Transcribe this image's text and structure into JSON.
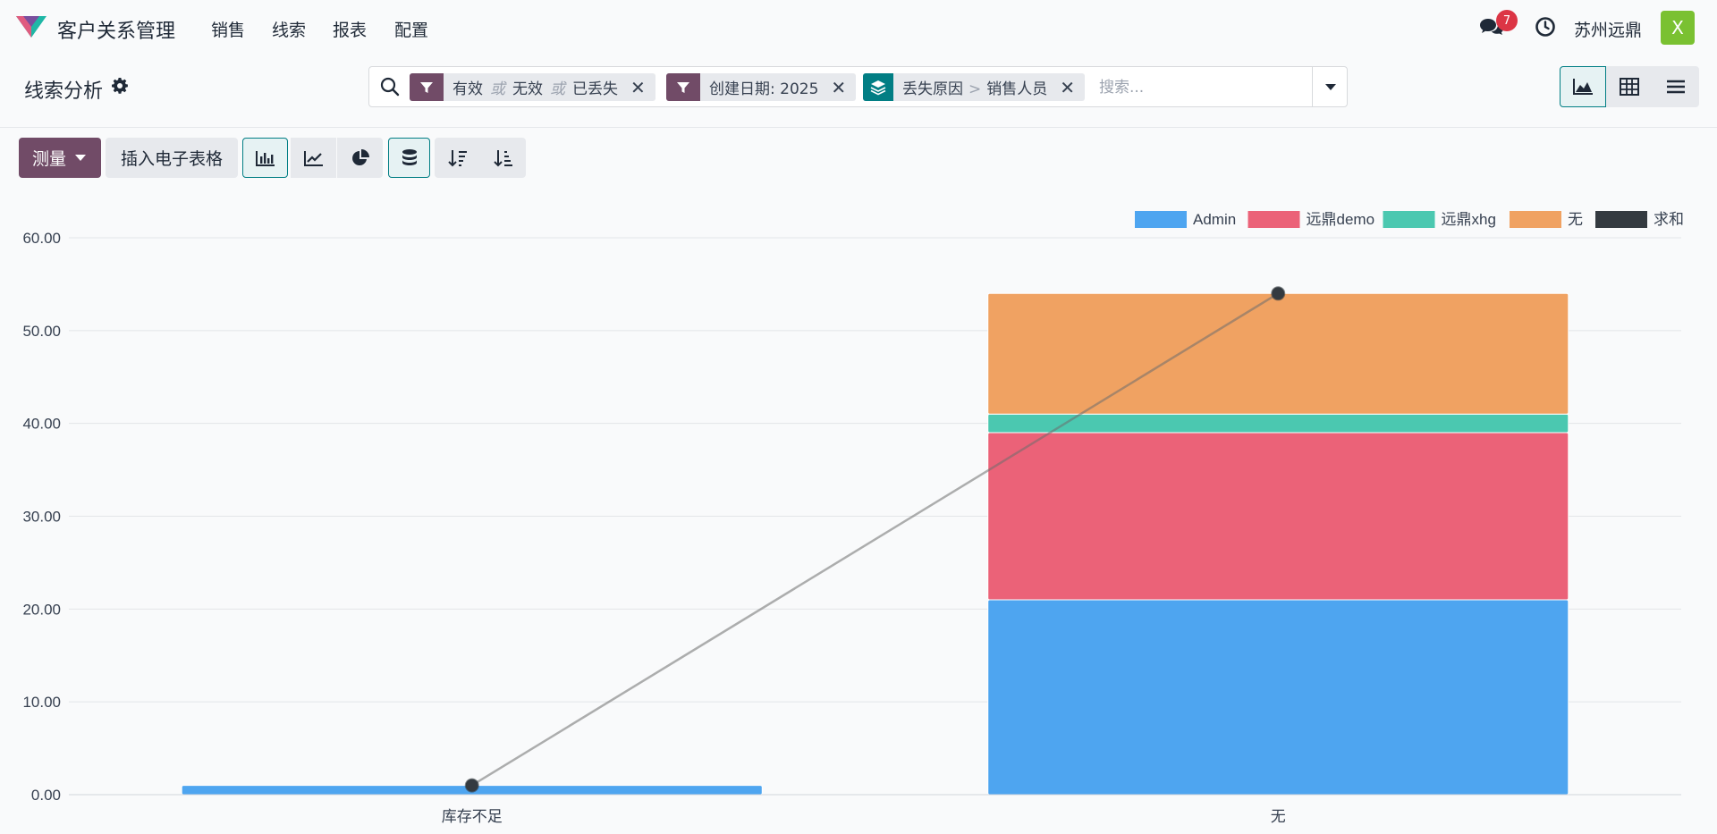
{
  "app": {
    "name": "客户关系管理"
  },
  "nav": {
    "items": [
      "销售",
      "线索",
      "报表",
      "配置"
    ]
  },
  "systray": {
    "messages_count": "7",
    "company": "苏州远鼎",
    "avatar_letter": "X"
  },
  "control_panel": {
    "title": "线索分析",
    "search": {
      "placeholder": "搜索...",
      "facets": [
        {
          "type": "filter",
          "values": [
            "有效",
            "无效",
            "已丢失"
          ],
          "separator": "或"
        },
        {
          "type": "filter",
          "values": [
            "创建日期: 2025"
          ]
        },
        {
          "type": "groupby",
          "values": [
            "丢失原因",
            "销售人员"
          ],
          "separator": ">"
        }
      ]
    },
    "views": [
      "graph",
      "pivot",
      "list"
    ],
    "active_view": "graph"
  },
  "toolbar": {
    "measure_label": "测量",
    "spreadsheet_label": "插入电子表格",
    "chart_types": [
      "bar",
      "line",
      "pie"
    ],
    "active_chart_type": "bar",
    "stacked": true
  },
  "colors": {
    "brand": "#714b67",
    "accent": "#017e84",
    "series": [
      "#4ea5f0",
      "#eb6278",
      "#4bc8b0",
      "#f0a262",
      "#343a40"
    ]
  },
  "chart_data": {
    "type": "bar",
    "stacked": true,
    "categories": [
      "库存不足",
      "无"
    ],
    "series": [
      {
        "name": "Admin",
        "values": [
          1,
          21
        ]
      },
      {
        "name": "远鼎demo",
        "values": [
          0,
          18
        ]
      },
      {
        "name": "远鼎xhg",
        "values": [
          0,
          2
        ]
      },
      {
        "name": "无",
        "values": [
          0,
          13
        ]
      }
    ],
    "line_series": {
      "name": "求和",
      "values": [
        1,
        54
      ]
    },
    "ylim": [
      0,
      60
    ],
    "yticks": [
      "0.00",
      "10.00",
      "20.00",
      "30.00",
      "40.00",
      "50.00",
      "60.00"
    ],
    "grid": true,
    "legend_position": "top-right"
  }
}
